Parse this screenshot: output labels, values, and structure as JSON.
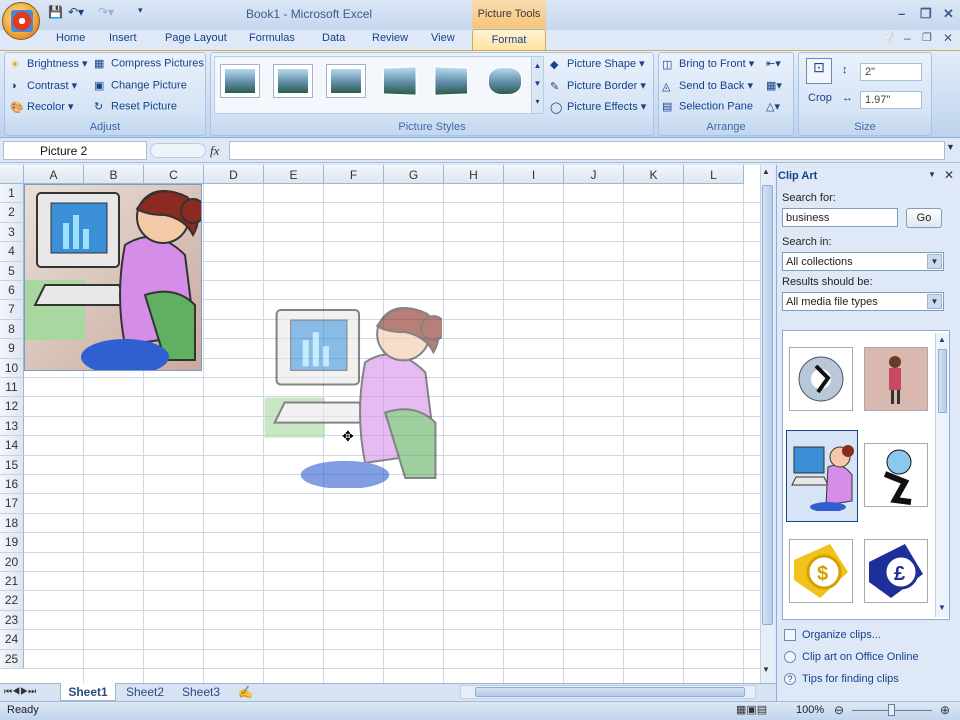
{
  "title": {
    "window": "Book1 - Microsoft Excel",
    "context_tools": "Picture Tools"
  },
  "tabs": [
    "Home",
    "Insert",
    "Page Layout",
    "Formulas",
    "Data",
    "Review",
    "View",
    "Format"
  ],
  "ribbon": {
    "adjust": {
      "label": "Adjust",
      "brightness": "Brightness",
      "contrast": "Contrast",
      "recolor": "Recolor",
      "compress": "Compress Pictures",
      "change": "Change Picture",
      "reset": "Reset Picture"
    },
    "styles": {
      "label": "Picture Styles",
      "shape": "Picture Shape",
      "border": "Picture Border",
      "effects": "Picture Effects"
    },
    "arrange": {
      "label": "Arrange",
      "front": "Bring to Front",
      "back": "Send to Back",
      "selection": "Selection Pane"
    },
    "size": {
      "label": "Size",
      "crop": "Crop",
      "height": "2\"",
      "width": "1.97\""
    }
  },
  "formula_bar": {
    "name_box": "Picture 2",
    "fx": "fx",
    "value": ""
  },
  "columns": [
    "A",
    "B",
    "C",
    "D",
    "E",
    "F",
    "G",
    "H",
    "I",
    "J",
    "K",
    "L"
  ],
  "rows": [
    "1",
    "2",
    "3",
    "4",
    "5",
    "6",
    "7",
    "8",
    "9",
    "10",
    "11",
    "12",
    "13",
    "14",
    "15",
    "16",
    "17",
    "18",
    "19",
    "20",
    "21",
    "22",
    "23",
    "24",
    "25"
  ],
  "sheets": [
    "Sheet1",
    "Sheet2",
    "Sheet3"
  ],
  "status": {
    "ready": "Ready",
    "zoom": "100%"
  },
  "clip_art": {
    "title": "Clip Art",
    "search_for_label": "Search for:",
    "search_value": "business",
    "go": "Go",
    "search_in_label": "Search in:",
    "search_in_value": "All collections",
    "results_label": "Results should be:",
    "results_value": "All media file types",
    "links": [
      "Organize clips...",
      "Clip art on Office Online",
      "Tips for finding clips"
    ]
  },
  "colors": {
    "ribbon": "#c9dbf1",
    "accent": "#f5c47a",
    "selection": "#15428b"
  }
}
